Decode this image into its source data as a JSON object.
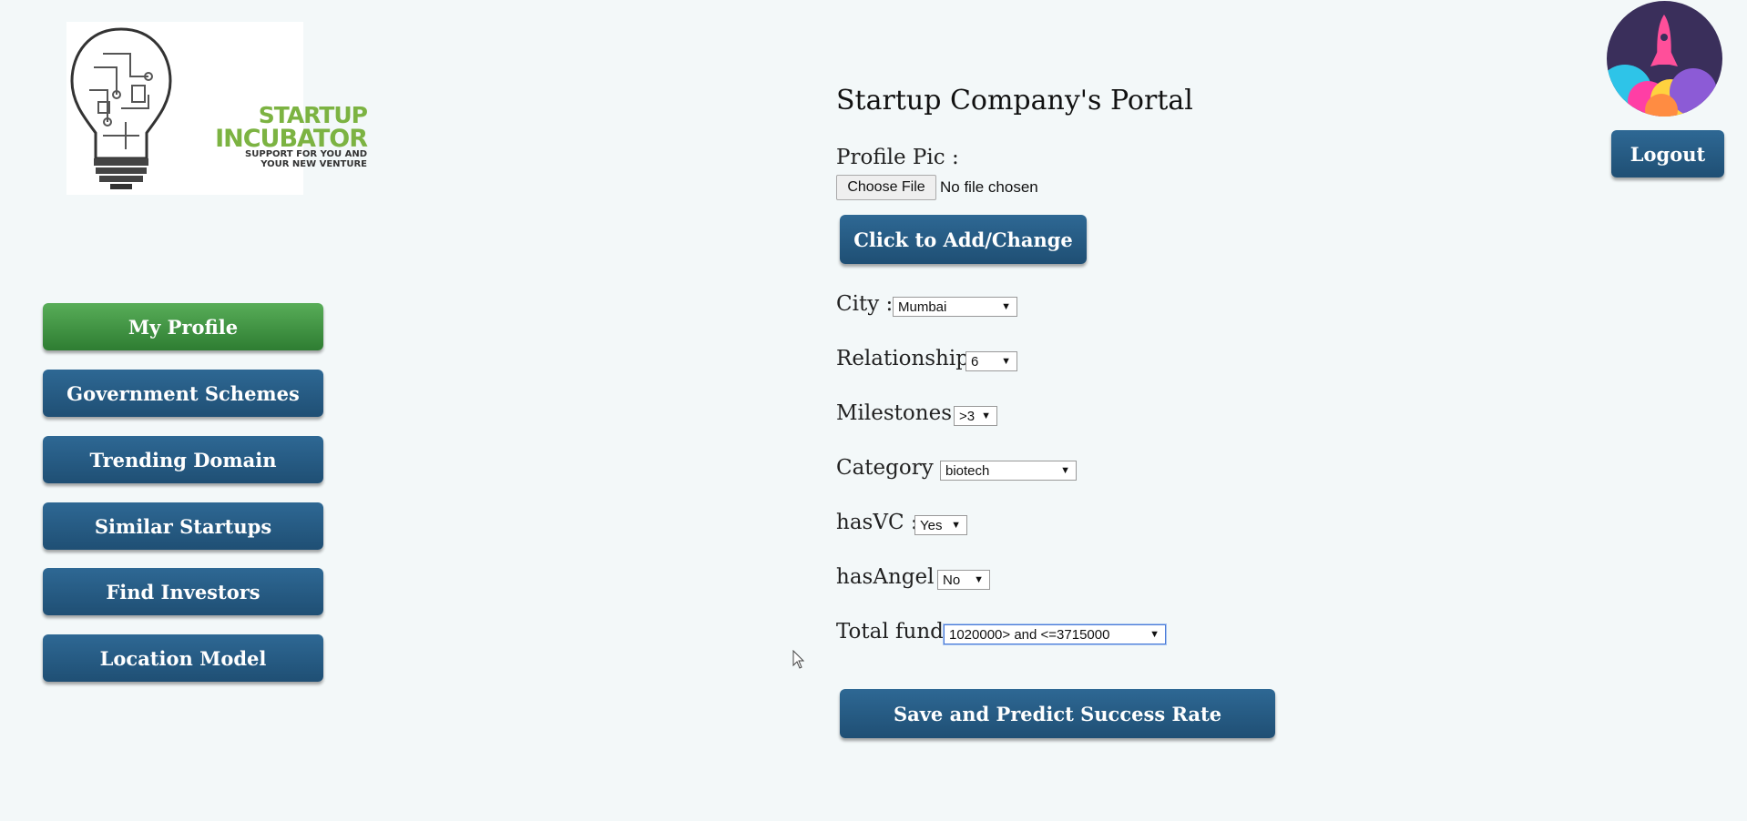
{
  "logo": {
    "line1": "STARTUP",
    "line2": "INCUBATOR",
    "tagline1": "SUPPORT FOR YOU AND",
    "tagline2": "YOUR NEW VENTURE"
  },
  "sidebar": {
    "items": [
      {
        "label": "My Profile",
        "active": true
      },
      {
        "label": "Government Schemes",
        "active": false
      },
      {
        "label": "Trending Domain",
        "active": false
      },
      {
        "label": "Similar Startups",
        "active": false
      },
      {
        "label": "Find Investors",
        "active": false
      },
      {
        "label": "Location Model",
        "active": false
      }
    ]
  },
  "header": {
    "logout_label": "Logout",
    "avatar_icon": "rocket-avatar-icon"
  },
  "form": {
    "title": "Startup Company's Portal",
    "profile_pic_label": "Profile Pic :",
    "choose_file_label": "Choose File",
    "file_status": "No file chosen",
    "add_change_label": "Click to Add/Change",
    "city_label": "City :",
    "city_value": "Mumbai",
    "relationship_label": "Relationship :",
    "relationship_value": "6",
    "milestones_label": "Milestones :",
    "milestones_value": ">3",
    "category_label": "Category :",
    "category_value": "biotech",
    "hasvc_label": "hasVC :",
    "hasvc_value": "Yes",
    "hasangel_label": "hasAngel :",
    "hasangel_value": "No",
    "total_fund_label": "Total fund :",
    "total_fund_value": "1020000> and <=3715000",
    "submit_label": "Save and Predict Success Rate"
  },
  "colors": {
    "primary_button": "#24557c",
    "active_button": "#3f9a47",
    "background": "#f3f8f9"
  }
}
